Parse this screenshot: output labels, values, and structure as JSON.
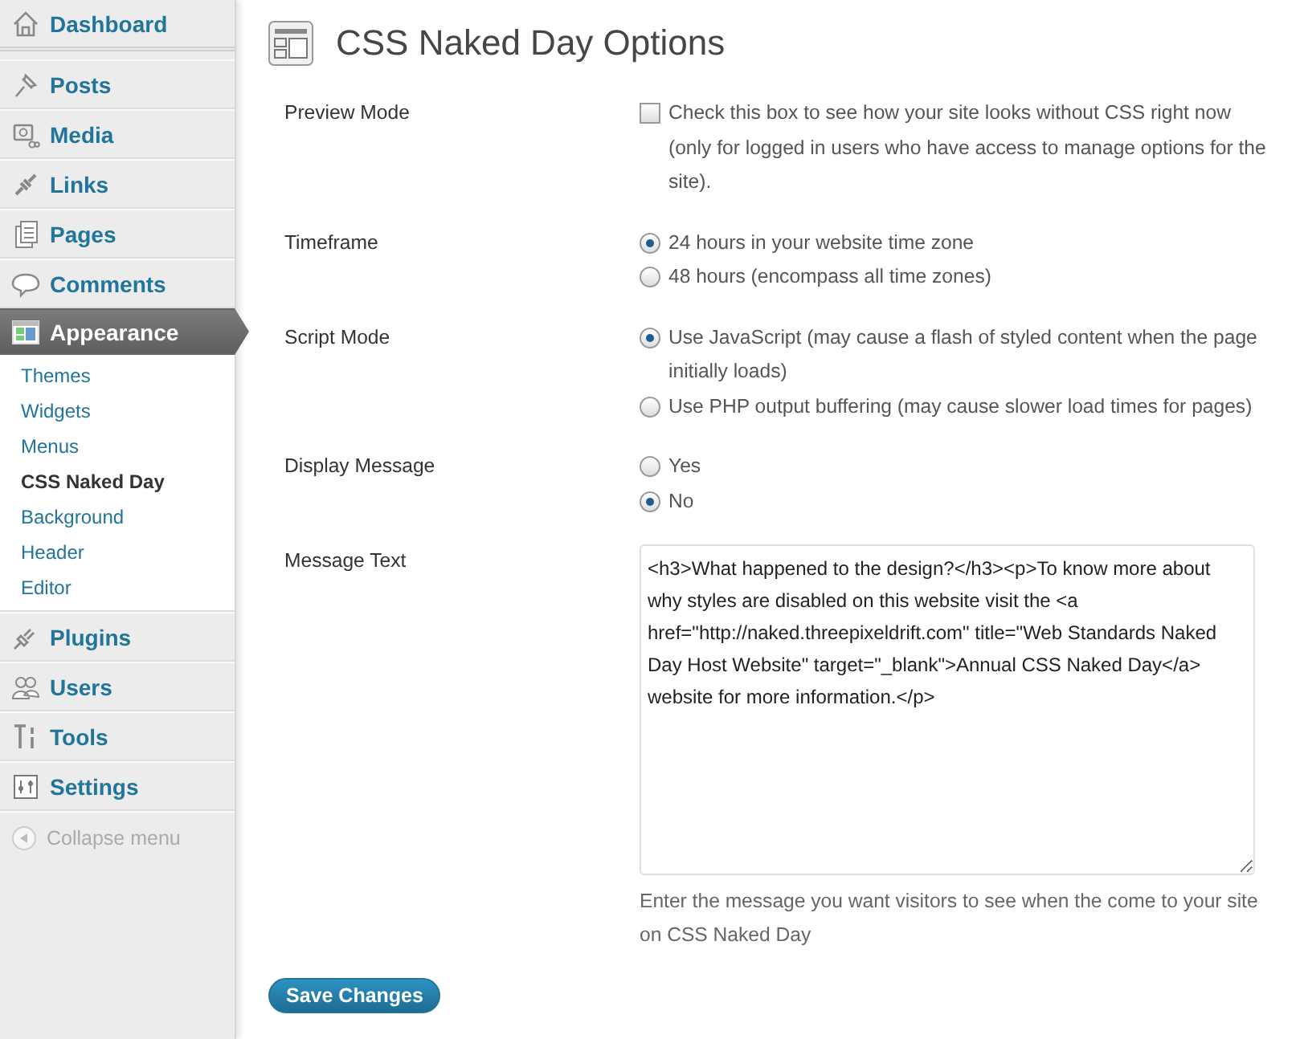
{
  "sidebar": {
    "items": [
      {
        "label": "Dashboard",
        "selected": false
      },
      {
        "label": "Posts",
        "selected": false
      },
      {
        "label": "Media",
        "selected": false
      },
      {
        "label": "Links",
        "selected": false
      },
      {
        "label": "Pages",
        "selected": false
      },
      {
        "label": "Comments",
        "selected": false
      },
      {
        "label": "Appearance",
        "selected": true,
        "expanded": true,
        "children": [
          {
            "label": "Themes",
            "selected": false
          },
          {
            "label": "Widgets",
            "selected": false
          },
          {
            "label": "Menus",
            "selected": false
          },
          {
            "label": "CSS Naked Day",
            "selected": true
          },
          {
            "label": "Background",
            "selected": false
          },
          {
            "label": "Header",
            "selected": false
          },
          {
            "label": "Editor",
            "selected": false
          }
        ]
      },
      {
        "label": "Plugins",
        "selected": false
      },
      {
        "label": "Users",
        "selected": false
      },
      {
        "label": "Tools",
        "selected": false
      },
      {
        "label": "Settings",
        "selected": false
      }
    ],
    "collapse": {
      "label": "Collapse menu"
    }
  },
  "page": {
    "title": "CSS Naked Day Options"
  },
  "settings": [
    {
      "label": "Preview Mode",
      "kind": "checkbox",
      "options": [
        {
          "text": "Check this box to see how your site looks without CSS right now (only for logged in users who have access to manage options for the site).",
          "checked": false
        }
      ]
    },
    {
      "label": "Timeframe",
      "kind": "radio",
      "options": [
        {
          "text": "24 hours in your website time zone",
          "selected": true
        },
        {
          "text": "48 hours (encompass all time zones)",
          "selected": false
        }
      ]
    },
    {
      "label": "Script Mode",
      "kind": "radio",
      "options": [
        {
          "text": "Use JavaScript (may cause a flash of styled content when the page initially loads)",
          "selected": true
        },
        {
          "text": "Use PHP output buffering (may cause slower load times for pages)",
          "selected": false
        }
      ]
    },
    {
      "label": "Display Message",
      "kind": "radio",
      "options": [
        {
          "text": "Yes",
          "selected": false
        },
        {
          "text": "No",
          "selected": true
        }
      ]
    },
    {
      "label": "Message Text",
      "kind": "textarea",
      "value": "<h3>What happened to the design?</h3><p>To know more about why styles are disabled on this website visit the <a href=\"http://naked.threepixeldrift.com\" title=\"Web Standards Naked Day Host Website\" target=\"_blank\">Annual CSS Naked Day</a> website for more information.</p>",
      "description": "Enter the message you want visitors to see when the come to your site on CSS Naked Day"
    }
  ],
  "save_button": "Save Changes"
}
